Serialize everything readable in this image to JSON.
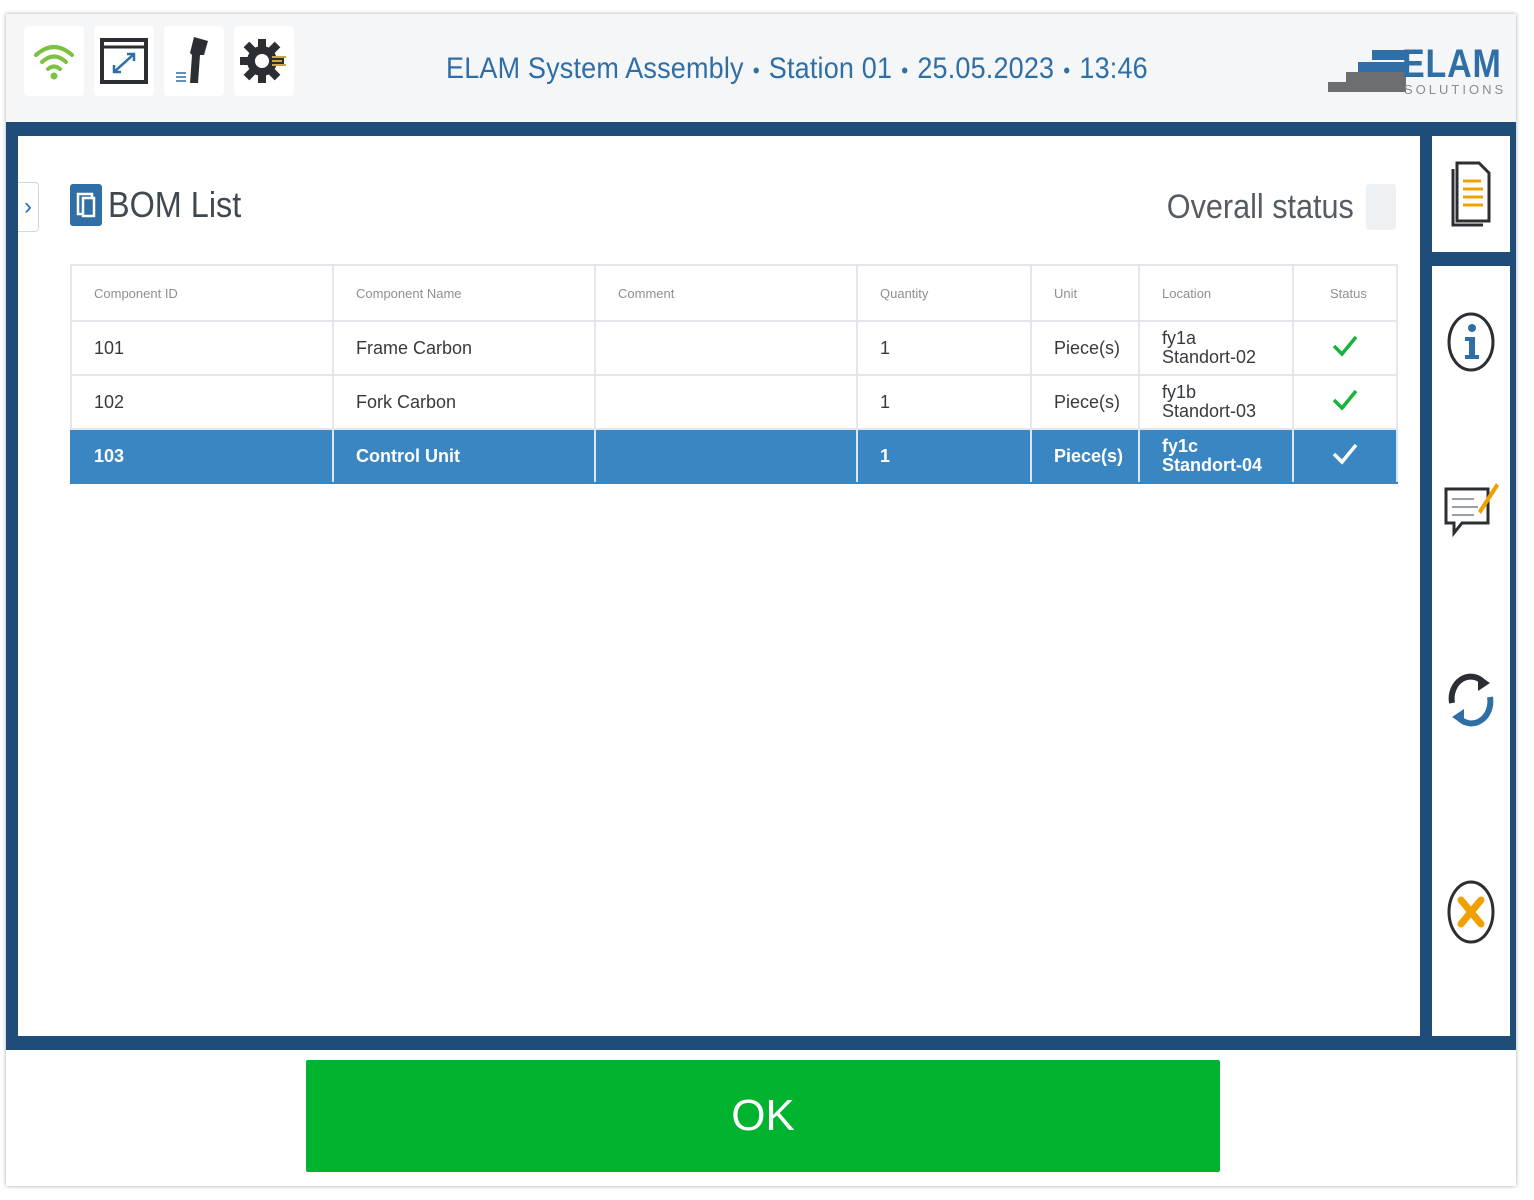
{
  "header": {
    "app_name": "ELAM System Assembly",
    "station": "Station 01",
    "date": "25.05.2023",
    "time": "13:46",
    "separator": "•",
    "icons": [
      "wifi-icon",
      "fullscreen-icon",
      "barcode-scanner-icon",
      "settings-icon"
    ],
    "logo_main": "ELAM",
    "logo_sub": "SOLUTIONS"
  },
  "panel": {
    "title": "BOM List",
    "overall_status_label": "Overall status"
  },
  "table": {
    "columns": [
      "Component ID",
      "Component Name",
      "Comment",
      "Quantity",
      "Unit",
      "Location",
      "Status"
    ],
    "rows": [
      {
        "id": "101",
        "name": "Frame Carbon",
        "comment": "",
        "quantity": "1",
        "unit": "Piece(s)",
        "location_line1": "fy1a",
        "location_line2": "Standort-02",
        "status": "ok"
      },
      {
        "id": "102",
        "name": "Fork Carbon",
        "comment": "",
        "quantity": "1",
        "unit": "Piece(s)",
        "location_line1": "fy1b",
        "location_line2": "Standort-03",
        "status": "ok"
      },
      {
        "id": "103",
        "name": "Control Unit",
        "comment": "",
        "quantity": "1",
        "unit": "Piece(s)",
        "location_line1": "fy1c",
        "location_line2": "Standort-04",
        "status": "ok",
        "selected": true
      }
    ]
  },
  "sidebar": {
    "buttons": [
      "document-icon",
      "info-icon",
      "comment-edit-icon",
      "refresh-icon",
      "cancel-icon"
    ]
  },
  "footer": {
    "ok_label": "OK"
  },
  "colors": {
    "accent_blue": "#2f6fa6",
    "frame_blue": "#1f4d7a",
    "selected_row": "#3a86c3",
    "ok_green": "#00b32e",
    "check_green": "#14b53a",
    "cancel_orange": "#f0a000"
  }
}
